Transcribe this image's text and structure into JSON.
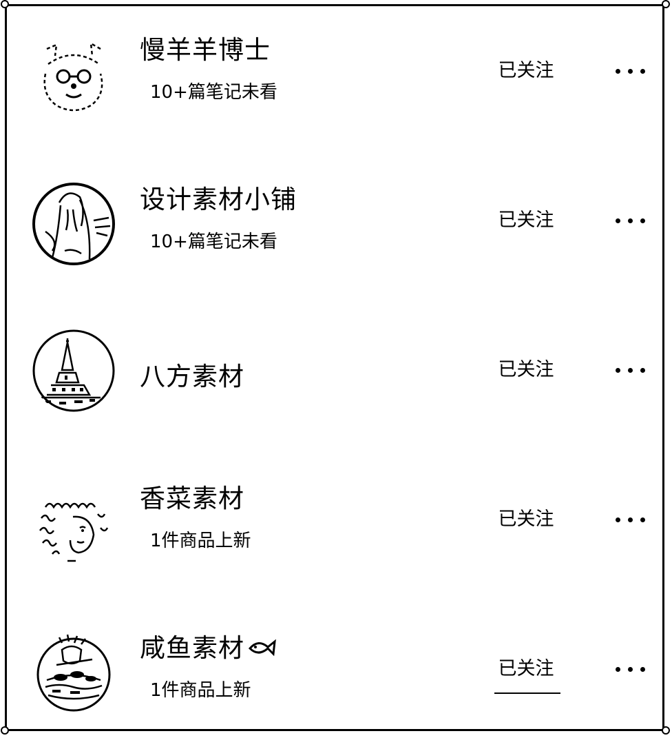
{
  "following_list": [
    {
      "name": "慢羊羊博士",
      "subtitle": "10+篇笔记未看",
      "follow_label": "已关注",
      "avatar_icon": "sheep-cartoon-icon",
      "more_icon": "more-dots-icon"
    },
    {
      "name": "设计素材小铺",
      "subtitle": "10+篇笔记未看",
      "follow_label": "已关注",
      "avatar_icon": "portrait-sketch-icon",
      "more_icon": "more-dots-icon"
    },
    {
      "name": "八方素材",
      "subtitle": "",
      "follow_label": "已关注",
      "avatar_icon": "tower-sketch-icon",
      "more_icon": "more-dots-icon"
    },
    {
      "name": "香菜素材",
      "subtitle": "1件商品上新",
      "follow_label": "已关注",
      "avatar_icon": "curly-hair-portrait-icon",
      "more_icon": "more-dots-icon"
    },
    {
      "name": "咸鱼素材",
      "subtitle": "1件商品上新",
      "follow_label": "已关注",
      "avatar_icon": "fishing-boat-sketch-icon",
      "name_suffix_icon": "fish-icon",
      "more_icon": "more-dots-icon"
    }
  ]
}
